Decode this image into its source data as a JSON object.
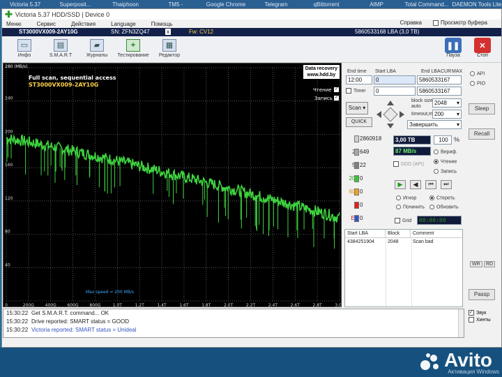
{
  "desktop_bar": [
    "Victoria 5.37",
    "Superposit...",
    "Thaiphoon",
    "TM5 -",
    "Google Chrome",
    "Telegram",
    "qBittorrent",
    "AIMP",
    "Total Command...",
    "DAEMON Tools Lite"
  ],
  "window": {
    "title": "Victoria 5.37 HDD/SSD | Device 0"
  },
  "menu": {
    "items": [
      "Меню",
      "Сервис",
      "Действия",
      "Language",
      "Помощь"
    ],
    "help": "Справка",
    "buffer_view": "Просмотр буфера"
  },
  "infobar": {
    "model": "ST3000VX009-2AY10G",
    "serial": "SN: ZFN3ZQ47",
    "close": "x",
    "firmware": "Fw: CV12",
    "lba": "5860533168 LBA (3,0 TB)"
  },
  "toolbar": {
    "info": "Инфо",
    "smart": "S.M.A.R.T",
    "journals": "Журналы",
    "testing": "Тестирование",
    "editor": "Редактор",
    "pause": "Пауза",
    "stop": "Стоп"
  },
  "graph": {
    "title": "Full scan, sequential access",
    "model": "ST3000VX009-2AY10G",
    "data_recovery": "Data recovery",
    "site": "www.hdd.by",
    "read_label": "Чтение",
    "write_label": "Запись",
    "max_speed": "Max speed = 200 MB/s",
    "top_label": "280 (MB/s)",
    "y_ticks": [
      "240",
      "200",
      "160",
      "120",
      "80",
      "40"
    ],
    "x_ticks": [
      "0",
      "200G",
      "400G",
      "600G",
      "800G",
      "1,0T",
      "1,2T",
      "1,4T",
      "1,6T",
      "1,8T",
      "2,0T",
      "2,2T",
      "2,4T",
      "2,6T",
      "2,8T",
      "3,0T"
    ],
    "line_color": "#3fd43f"
  },
  "params": {
    "end_time_label": "End time",
    "start_lba_label": "Start LBA",
    "end_lba_label": "End LBA",
    "cur_label": "CUR",
    "max_label": "MAX",
    "end_time": "12:00",
    "start_lba": "0",
    "end_lba": "5860533167",
    "end_lba2": "5860533167",
    "timer_label": "Timer",
    "timer_value": "0",
    "scan_btn": "Scan",
    "quick_btn": "QUICK",
    "block_size_label": "block size",
    "auto_label": "auto",
    "block_size": "2048",
    "timeout_label": "timeout,ms",
    "timeout": "200",
    "action_select": "Завершить"
  },
  "stats": {
    "capacity": "3,00 TB",
    "percent": "100",
    "percent_sign": "%",
    "speed": "87 MB/s",
    "verify": "Вериф.",
    "read": "Чтение",
    "write": "Запись",
    "ddd": "DDD (API)",
    "blocks": [
      {
        "label": "5",
        "value": "2860918",
        "color": "#cfcfcf"
      },
      {
        "label": "20",
        "value": "649",
        "color": "#a8a8a8"
      },
      {
        "label": "50",
        "value": "22",
        "color": "#808080"
      },
      {
        "label": "200",
        "value": "0",
        "color": "#35c435"
      },
      {
        "label": "600",
        "value": "0",
        "color": "#f0a020"
      },
      {
        "label": ">",
        "value": "0",
        "color": "#e02020"
      },
      {
        "label": "Err",
        "value": "0",
        "color": "#3355cc"
      }
    ],
    "ignore": "Игнор",
    "erase": "Стереть",
    "repair": "Починить",
    "refresh": "Обновить",
    "grid": "Grid",
    "timer_display": "00:00:00"
  },
  "error_table": {
    "headers": [
      "Start LBA",
      "Block",
      "Comment"
    ],
    "rows": [
      [
        "4384251904",
        "2048",
        "Scan bad"
      ]
    ]
  },
  "side": {
    "api": "API",
    "pio": "PIO",
    "sleep": "Sleep",
    "recall": "Recall",
    "wr": "WR",
    "rd": "RD",
    "passp": "Passp",
    "sound": "Звук",
    "hints": "Хинты"
  },
  "log": [
    {
      "time": "15:30:22",
      "text": "Get S.M.A.R.T. command... OK"
    },
    {
      "time": "15:30:22",
      "text": "Drive reported: SMART status = GOOD"
    },
    {
      "time": "15:30:22",
      "text": "Victoria reported: SMART status = Unideal"
    }
  ],
  "watermark": {
    "brand": "Avito",
    "activation": "Активация Windows"
  }
}
